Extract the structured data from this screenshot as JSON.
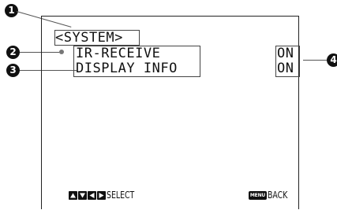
{
  "osd": {
    "title": "<SYSTEM>",
    "items": [
      {
        "label": "IR-RECEIVE",
        "value": "ON"
      },
      {
        "label": "DISPLAY INFO",
        "value": "ON"
      }
    ]
  },
  "callouts": [
    "1",
    "2",
    "3",
    "4"
  ],
  "footer": {
    "select_icons": [
      "up-arrow-icon",
      "down-arrow-icon",
      "left-arrow-icon",
      "right-arrow-icon"
    ],
    "select_label": "SELECT",
    "menu_key_label": "MENU",
    "back_label": "BACK"
  }
}
